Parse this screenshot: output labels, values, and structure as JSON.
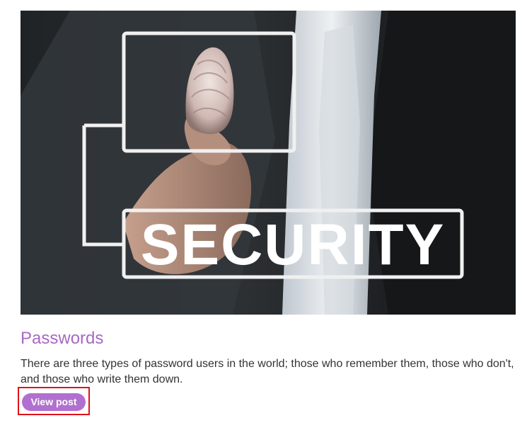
{
  "post": {
    "image": {
      "alt": "Security fingerprint image",
      "overlay_text": "SECURITY"
    },
    "title": "Passwords",
    "summary": "There are three types of password users in the world; those who remember them, those who don't, and those who write them down.",
    "button_label": "View post"
  },
  "colors": {
    "title": "#a869c4",
    "button": "#b170cf",
    "highlight": "#e0131a",
    "summary_text": "#333333"
  }
}
